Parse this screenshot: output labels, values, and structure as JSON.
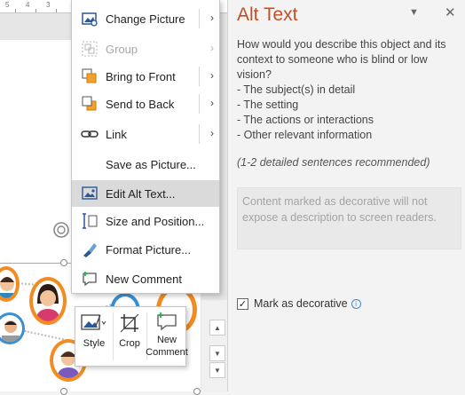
{
  "ruler": {
    "ticks": [
      "5",
      "4",
      "3"
    ]
  },
  "context_menu": {
    "items": [
      {
        "label": "Change Picture",
        "has_submenu": true,
        "disabled": false,
        "icon": "change-picture-icon"
      },
      {
        "label": "Group",
        "has_submenu": true,
        "disabled": true,
        "icon": "group-icon"
      },
      {
        "label": "Bring to Front",
        "has_submenu": true,
        "disabled": false,
        "icon": "bring-to-front-icon"
      },
      {
        "label": "Send to Back",
        "has_submenu": true,
        "disabled": false,
        "icon": "send-to-back-icon"
      },
      {
        "label": "Link",
        "has_submenu": true,
        "disabled": false,
        "icon": "link-icon"
      },
      {
        "label": "Save as Picture...",
        "has_submenu": false,
        "disabled": false,
        "icon": ""
      },
      {
        "label": "Edit Alt Text...",
        "has_submenu": false,
        "disabled": false,
        "highlighted": true,
        "icon": "alt-text-icon"
      },
      {
        "label": "Size and Position...",
        "has_submenu": false,
        "disabled": false,
        "icon": "size-position-icon"
      },
      {
        "label": "Format Picture...",
        "has_submenu": false,
        "disabled": false,
        "icon": "format-picture-icon"
      },
      {
        "label": "New Comment",
        "has_submenu": false,
        "disabled": false,
        "icon": "new-comment-icon"
      }
    ],
    "submenu_arrow": "›"
  },
  "mini_toolbar": {
    "style_label": "Style",
    "crop_label": "Crop",
    "comment_label_line1": "New",
    "comment_label_line2": "Comment"
  },
  "alt_text_pane": {
    "title": "Alt Text",
    "dropdown_glyph": "▼",
    "close_glyph": "✕",
    "description_lines": [
      "How would you describe this object and its",
      "context to someone who is blind or low",
      "vision?",
      "- The subject(s) in detail",
      "- The setting",
      "- The actions or interactions",
      "- Other relevant information"
    ],
    "recommendation": "(1-2 detailed sentences recommended)",
    "input_placeholder": "Content marked as decorative will not expose a description to screen readers.",
    "decorative_label": "Mark as decorative",
    "decorative_checked": true,
    "check_glyph": "✓",
    "info_glyph": "i"
  },
  "colors": {
    "pane_title": "#c04f25",
    "menu_highlight": "#dadada",
    "avatar_ring_orange": "#f28c22",
    "avatar_ring_blue": "#3a8fd6"
  }
}
